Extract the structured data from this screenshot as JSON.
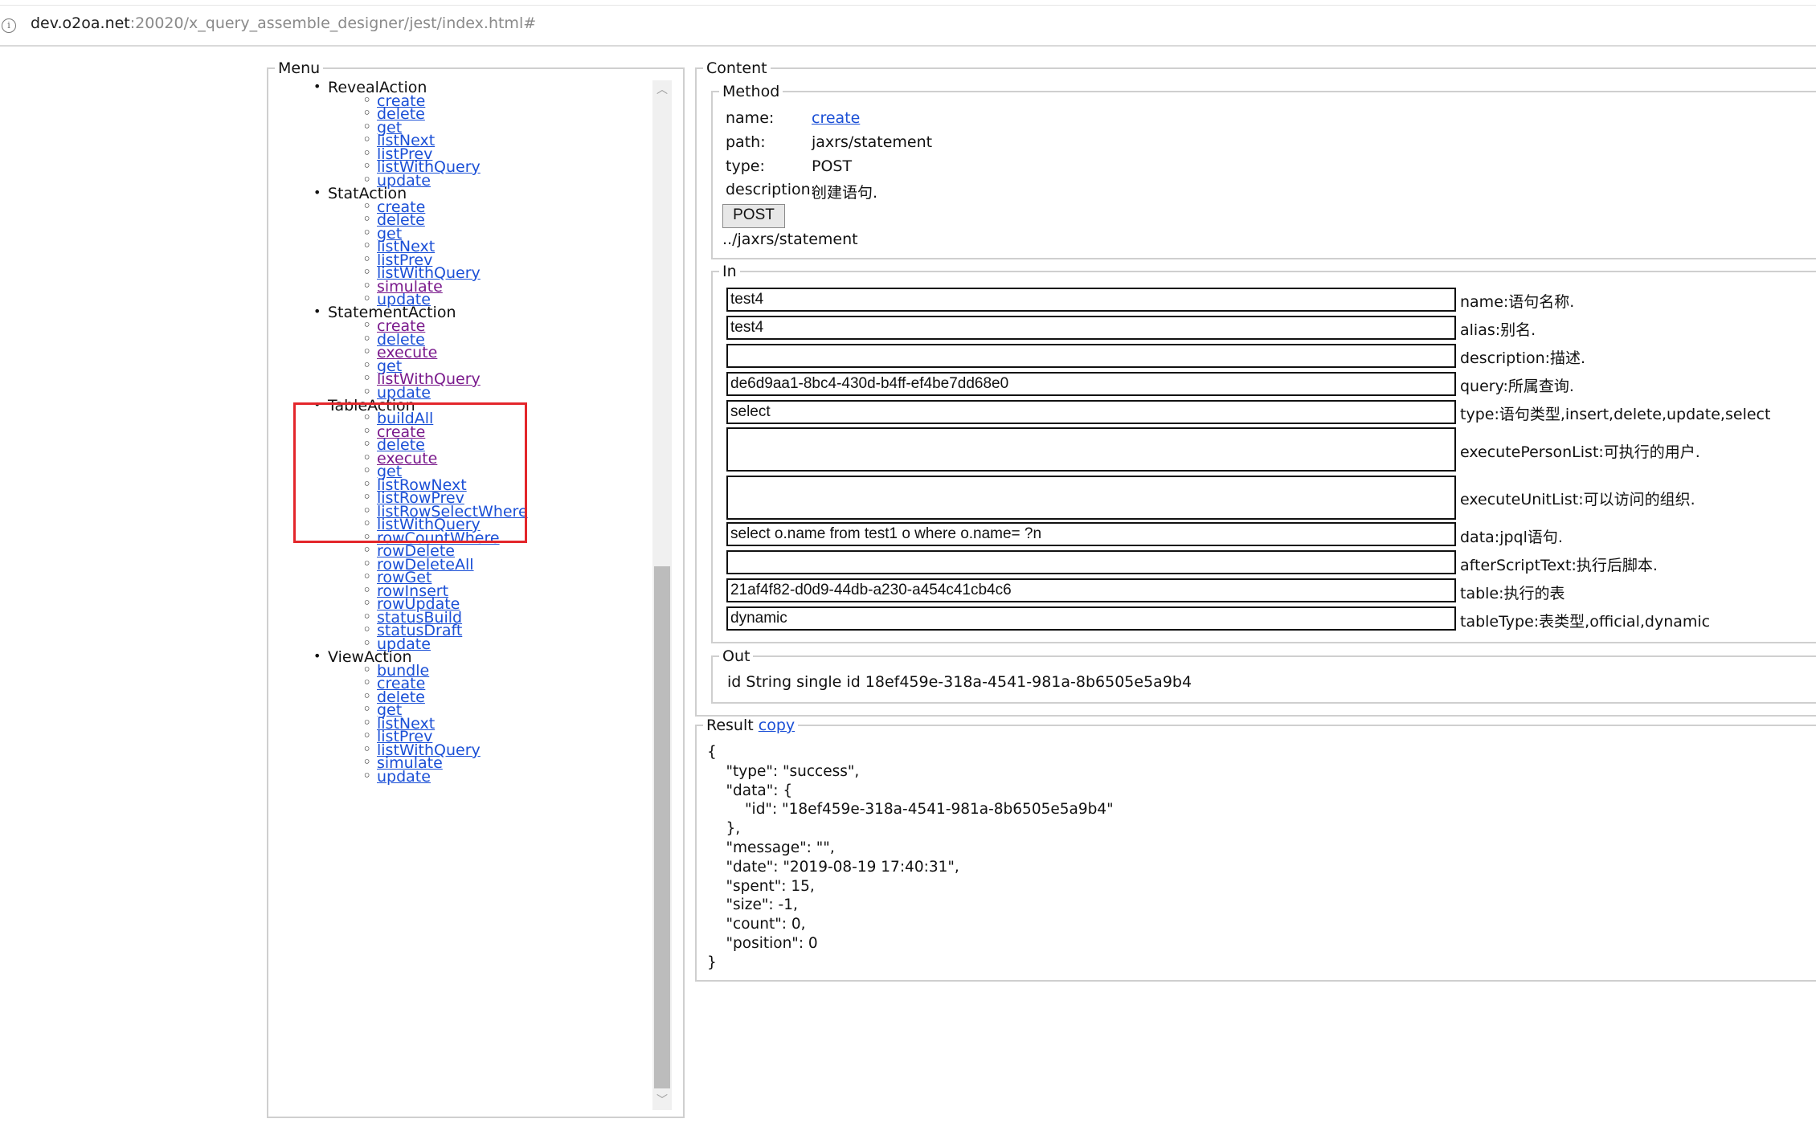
{
  "address_bar": {
    "host": "dev.o2oa.net",
    "path": ":20020/x_query_assemble_designer/jest/index.html#"
  },
  "menu": {
    "legend": "Menu",
    "groups": [
      {
        "name": "RevealAction",
        "items": [
          "create",
          "delete",
          "get",
          "listNext",
          "listPrev",
          "listWithQuery",
          "update"
        ]
      },
      {
        "name": "StatAction",
        "items": [
          "create",
          "delete",
          "get",
          "listNext",
          "listPrev",
          "listWithQuery",
          "simulate",
          "update"
        ]
      },
      {
        "name": "StatementAction",
        "items": [
          "create",
          "delete",
          "execute",
          "get",
          "listWithQuery",
          "update"
        ]
      },
      {
        "name": "TableAction",
        "items": [
          "buildAll",
          "create",
          "delete",
          "execute",
          "get",
          "listRowNext",
          "listRowPrev",
          "listRowSelectWhere",
          "listWithQuery",
          "rowCountWhere",
          "rowDelete",
          "rowDeleteAll",
          "rowGet",
          "rowInsert",
          "rowUpdate",
          "statusBuild",
          "statusDraft",
          "update"
        ]
      },
      {
        "name": "ViewAction",
        "items": [
          "bundle",
          "create",
          "delete",
          "get",
          "listNext",
          "listPrev",
          "listWithQuery",
          "simulate",
          "update"
        ]
      }
    ]
  },
  "content": {
    "legend": "Content",
    "method": {
      "legend": "Method",
      "name_label": "name:",
      "name_value": "create",
      "path_label": "path:",
      "path_value": "jaxrs/statement",
      "type_label": "type:",
      "type_value": "POST",
      "description_label": "description:",
      "description_value": "创建语句.",
      "button_label": "POST",
      "url": "../jaxrs/statement"
    },
    "in": {
      "legend": "In",
      "fields": [
        {
          "value": "test4",
          "label": "name:语句名称."
        },
        {
          "value": "test4",
          "label": "alias:别名."
        },
        {
          "value": "",
          "label": "description:描述."
        },
        {
          "value": "de6d9aa1-8bc4-430d-b4ff-ef4be7dd68e0",
          "label": "query:所属查询."
        },
        {
          "value": "select",
          "label": "type:语句类型,insert,delete,update,select"
        },
        {
          "value": "",
          "label": "executePersonList:可执行的用户."
        },
        {
          "value": "",
          "label": "executeUnitList:可以访问的组织."
        },
        {
          "value": "select o.name  from test1 o where o.name= ?n",
          "label": "data:jpql语句."
        },
        {
          "value": "",
          "label": "afterScriptText:执行后脚本."
        },
        {
          "value": "21af4f82-d0d9-44db-a230-a454c41cb4c6",
          "label": "table:执行的表"
        },
        {
          "value": "dynamic",
          "label": "tableType:表类型,official,dynamic"
        }
      ]
    },
    "out": {
      "legend": "Out",
      "text": "id String single id 18ef459e-318a-4541-981a-8b6505e5a9b4"
    }
  },
  "result": {
    "legend": "Result",
    "copy_label": "copy",
    "json_text": "{\n    \"type\": \"success\",\n    \"data\": {\n        \"id\": \"18ef459e-318a-4541-981a-8b6505e5a9b4\"\n    },\n    \"message\": \"\",\n    \"date\": \"2019-08-19 17:40:31\",\n    \"spent\": 15,\n    \"size\": -1,\n    \"count\": 0,\n    \"position\": 0\n}"
  },
  "colors": {
    "link": "#1a4fd6",
    "visited_link": "#7a1a8c",
    "highlight_box": "#e3262b"
  }
}
